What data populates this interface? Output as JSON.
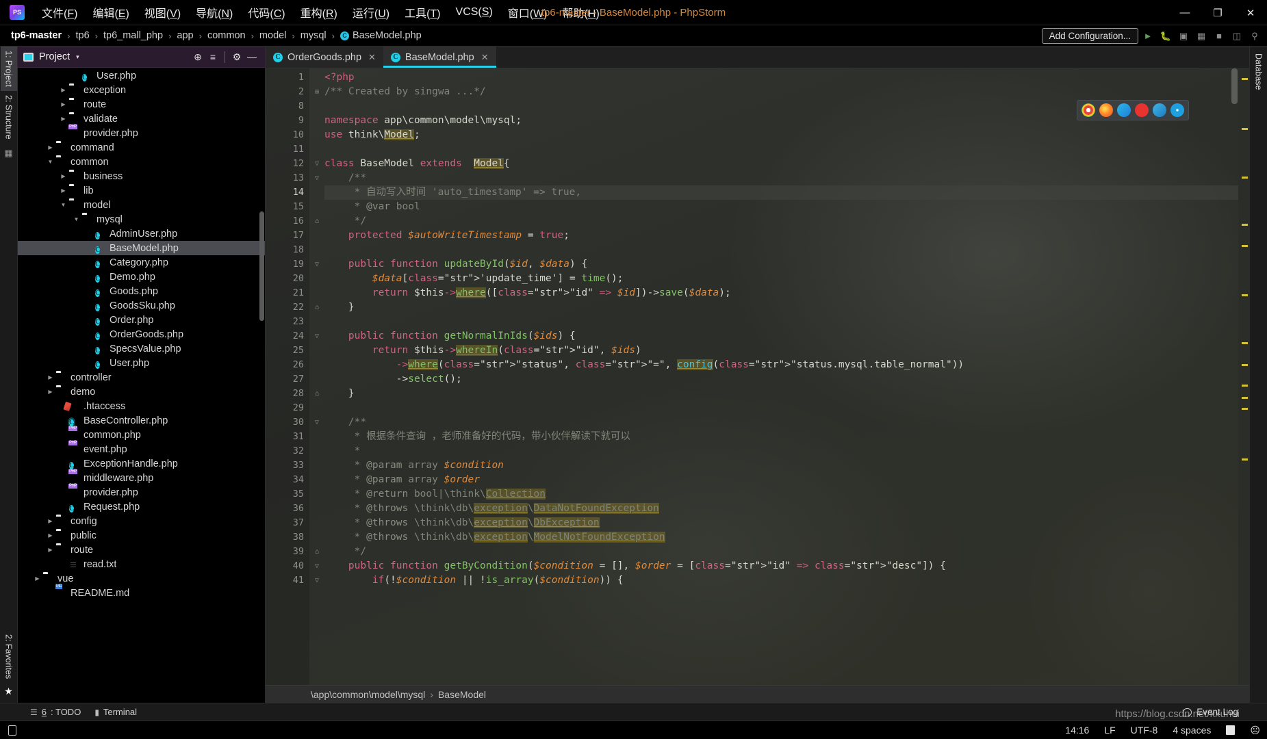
{
  "window": {
    "title": "tp6-master - BaseModel.php - PhpStorm",
    "minimize": "—",
    "maximize": "❐",
    "close": "✕"
  },
  "menu": {
    "items": [
      {
        "text": "文件(",
        "mn": "F",
        "tail": ")"
      },
      {
        "text": "编辑(",
        "mn": "E",
        "tail": ")"
      },
      {
        "text": "视图(",
        "mn": "V",
        "tail": ")"
      },
      {
        "text": "导航(",
        "mn": "N",
        "tail": ")"
      },
      {
        "text": "代码(",
        "mn": "C",
        "tail": ")"
      },
      {
        "text": "重构(",
        "mn": "R",
        "tail": ")"
      },
      {
        "text": "运行(",
        "mn": "U",
        "tail": ")"
      },
      {
        "text": "工具(",
        "mn": "T",
        "tail": ")"
      },
      {
        "text": "VCS(",
        "mn": "S",
        "tail": ")"
      },
      {
        "text": "窗口(",
        "mn": "W",
        "tail": ")"
      },
      {
        "text": "帮助(",
        "mn": "H",
        "tail": ")"
      }
    ]
  },
  "breadcrumb": {
    "items": [
      "tp6-master",
      "tp6",
      "tp6_mall_php",
      "app",
      "common",
      "model",
      "mysql"
    ],
    "file": "BaseModel.php",
    "file_icon_letter": "C",
    "separator": "›"
  },
  "nav_right": {
    "add_configuration": "Add Configuration...",
    "icons": [
      "run-icon",
      "debug-icon",
      "coverage-icon",
      "profile-icon",
      "stop-icon",
      "layout-icon",
      "search-icon"
    ]
  },
  "left_strip": {
    "project_tab": "1: Project",
    "structure_tab": "2: Structure",
    "favorites_tab": "2: Favorites"
  },
  "right_strip": {
    "database_tab": "Database"
  },
  "project_panel": {
    "title": "Project",
    "caret": "▾",
    "locate_icon": "⊕",
    "collapse_icon": "≡",
    "settings_icon": "⚙",
    "hide_icon": "—",
    "tree": [
      {
        "indent": 4,
        "arrow": "",
        "icon": "class",
        "label": "User.php"
      },
      {
        "indent": 3,
        "arrow": "▶",
        "icon": "folder",
        "label": "exception"
      },
      {
        "indent": 3,
        "arrow": "▶",
        "icon": "folder",
        "label": "route"
      },
      {
        "indent": 3,
        "arrow": "▶",
        "icon": "folder",
        "label": "validate"
      },
      {
        "indent": 3,
        "arrow": "",
        "icon": "php",
        "label": "provider.php"
      },
      {
        "indent": 2,
        "arrow": "▶",
        "icon": "folder",
        "label": "command"
      },
      {
        "indent": 2,
        "arrow": "▼",
        "icon": "folder",
        "label": "common"
      },
      {
        "indent": 3,
        "arrow": "▶",
        "icon": "folder",
        "label": "business"
      },
      {
        "indent": 3,
        "arrow": "▶",
        "icon": "folder",
        "label": "lib"
      },
      {
        "indent": 3,
        "arrow": "▼",
        "icon": "folder",
        "label": "model"
      },
      {
        "indent": 4,
        "arrow": "▼",
        "icon": "folder",
        "label": "mysql"
      },
      {
        "indent": 5,
        "arrow": "",
        "icon": "class",
        "label": "AdminUser.php"
      },
      {
        "indent": 5,
        "arrow": "",
        "icon": "class",
        "label": "BaseModel.php",
        "selected": true
      },
      {
        "indent": 5,
        "arrow": "",
        "icon": "class",
        "label": "Category.php"
      },
      {
        "indent": 5,
        "arrow": "",
        "icon": "class",
        "label": "Demo.php"
      },
      {
        "indent": 5,
        "arrow": "",
        "icon": "class",
        "label": "Goods.php"
      },
      {
        "indent": 5,
        "arrow": "",
        "icon": "class",
        "label": "GoodsSku.php"
      },
      {
        "indent": 5,
        "arrow": "",
        "icon": "class",
        "label": "Order.php"
      },
      {
        "indent": 5,
        "arrow": "",
        "icon": "class",
        "label": "OrderGoods.php"
      },
      {
        "indent": 5,
        "arrow": "",
        "icon": "class",
        "label": "SpecsValue.php"
      },
      {
        "indent": 5,
        "arrow": "",
        "icon": "class",
        "label": "User.php"
      },
      {
        "indent": 2,
        "arrow": "▶",
        "icon": "folder",
        "label": "controller"
      },
      {
        "indent": 2,
        "arrow": "▶",
        "icon": "folder",
        "label": "demo"
      },
      {
        "indent": 3,
        "arrow": "",
        "icon": "htaccess",
        "label": ".htaccess"
      },
      {
        "indent": 3,
        "arrow": "",
        "icon": "class-ring",
        "label": "BaseController.php"
      },
      {
        "indent": 3,
        "arrow": "",
        "icon": "php",
        "label": "common.php"
      },
      {
        "indent": 3,
        "arrow": "",
        "icon": "php",
        "label": "event.php"
      },
      {
        "indent": 3,
        "arrow": "",
        "icon": "class",
        "label": "ExceptionHandle.php"
      },
      {
        "indent": 3,
        "arrow": "",
        "icon": "php",
        "label": "middleware.php"
      },
      {
        "indent": 3,
        "arrow": "",
        "icon": "php",
        "label": "provider.php"
      },
      {
        "indent": 3,
        "arrow": "",
        "icon": "class",
        "label": "Request.php"
      },
      {
        "indent": 2,
        "arrow": "▶",
        "icon": "folder",
        "label": "config"
      },
      {
        "indent": 2,
        "arrow": "▶",
        "icon": "folder",
        "label": "public"
      },
      {
        "indent": 2,
        "arrow": "▶",
        "icon": "folder",
        "label": "route"
      },
      {
        "indent": 3,
        "arrow": "",
        "icon": "txt",
        "label": "read.txt"
      },
      {
        "indent": 1,
        "arrow": "▶",
        "icon": "folder",
        "label": "vue"
      },
      {
        "indent": 2,
        "arrow": "",
        "icon": "md",
        "label": "README.md"
      }
    ]
  },
  "tabs": [
    {
      "label": "OrderGoods.php",
      "icon_letter": "C",
      "close": "✕",
      "active": false
    },
    {
      "label": "BaseModel.php",
      "icon_letter": "C",
      "close": "✕",
      "active": true
    }
  ],
  "editor": {
    "language": "PHP",
    "caret_line": 14,
    "first_line": 1,
    "lines": [
      1,
      2,
      8,
      9,
      10,
      11,
      12,
      13,
      14,
      15,
      16,
      17,
      18,
      19,
      20,
      21,
      22,
      23,
      24,
      25,
      26,
      27,
      28,
      29,
      30,
      31,
      32,
      33,
      34,
      35,
      36,
      37,
      38,
      39,
      40,
      41
    ],
    "code": [
      "<?php",
      "/** Created by singwa ...*/",
      "",
      "namespace app\\common\\model\\mysql;",
      "use think\\Model;",
      "",
      "class BaseModel extends  Model{",
      "    /**",
      "     * 自动写入时间 'auto_timestamp' => true,",
      "     * @var bool",
      "     */",
      "    protected $autoWriteTimestamp = true;",
      "",
      "    public function updateById($id, $data) {",
      "        $data['update_time'] = time();",
      "        return $this->where([\"id\" => $id])->save($data);",
      "    }",
      "",
      "    public function getNormalInIds($ids) {",
      "        return $this->whereIn(\"id\", $ids)",
      "            ->where(\"status\", \"=\", config(\"status.mysql.table_normal\"))",
      "            ->select();",
      "    }",
      "",
      "    /**",
      "     * 根据条件查询 ，老师准备好的代码，带小伙伴解读下就可以",
      "     *",
      "     * @param array $condition",
      "     * @param array $order",
      "     * @return bool|\\think\\Collection",
      "     * @throws \\think\\db\\exception\\DataNotFoundException",
      "     * @throws \\think\\db\\exception\\DbException",
      "     * @throws \\think\\db\\exception\\ModelNotFoundException",
      "     */",
      "    public function getByCondition($condition = [], $order = [\"id\" => \"desc\"]) {",
      "        if(!$condition || !is_array($condition)) {"
    ],
    "breadcrumb_path": "\\app\\common\\model\\mysql",
    "breadcrumb_class": "BaseModel",
    "breadcrumb_sep": "›"
  },
  "bottom_tools": {
    "todo_num": "6",
    "todo_label": ": TODO",
    "terminal_label": "Terminal",
    "event_log": "Event Log"
  },
  "status_bar": {
    "time": "14:16",
    "line_separator": "LF",
    "encoding": "UTF-8",
    "indent": "4 spaces",
    "lock_icon": "lock-icon",
    "face_icon": "☹"
  },
  "watermark": "https://blog.csdn.net/kxuhui",
  "colors": {
    "accent": "#2ad0ea",
    "title": "#d2873f",
    "selection": "#4b4b52",
    "editor_bg": "#2d2f2c"
  }
}
